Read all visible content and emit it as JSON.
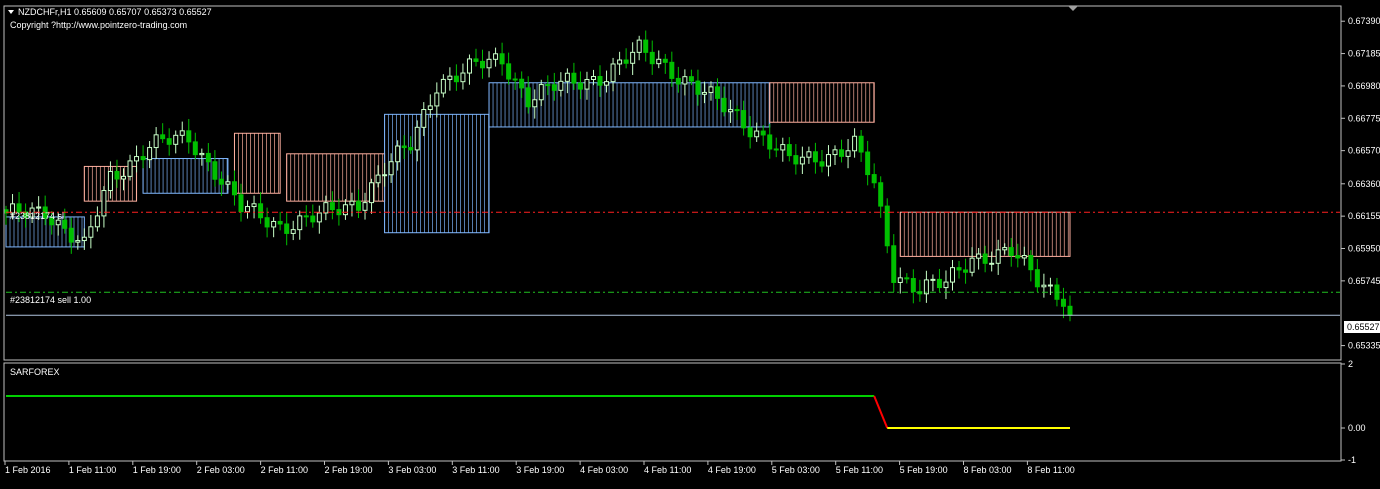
{
  "header": {
    "symbol_line": "NZDCHFr,H1  0.65609 0.65707 0.65373 0.65527",
    "copyright": "Copyright ?http://www.pointzero-trading.com"
  },
  "price_axis": {
    "ticks": [
      "0.67390",
      "0.67185",
      "0.66980",
      "0.66775",
      "0.66570",
      "0.66360",
      "0.66155",
      "0.65950",
      "0.65745",
      "0.65335"
    ],
    "current_price_label": "0.65527"
  },
  "order_lines": {
    "sl_label": "#23812174 sl",
    "sell_label": "#23812174 sell 1.00",
    "sl_price": 0.6618,
    "entry_price": 0.65673,
    "sl_color": "#ff2020",
    "entry_color": "#20c020",
    "bid_color": "#b0c4de"
  },
  "indicator": {
    "name": "SARFOREX",
    "ticks": [
      "2",
      "0.00",
      "-1"
    ],
    "ylim": [
      -1,
      2
    ],
    "segments": [
      {
        "color": "#00d000",
        "from_bar": 0,
        "to_bar": 133,
        "value": 1
      },
      {
        "color": "#ff0000",
        "from_bar": 133,
        "to_bar": 135,
        "value_from": 1,
        "value_to": 0
      },
      {
        "color": "#ffff00",
        "from_bar": 135,
        "to_bar": 163,
        "value": 0
      }
    ]
  },
  "time_axis": {
    "labels": [
      "1 Feb 2016",
      "1 Feb 11:00",
      "1 Feb 19:00",
      "2 Feb 03:00",
      "2 Feb 11:00",
      "2 Feb 19:00",
      "3 Feb 03:00",
      "3 Feb 11:00",
      "3 Feb 19:00",
      "4 Feb 03:00",
      "4 Feb 11:00",
      "4 Feb 19:00",
      "5 Feb 03:00",
      "5 Feb 11:00",
      "5 Feb 19:00",
      "8 Feb 03:00",
      "8 Feb 11:00"
    ]
  },
  "colors": {
    "background": "#000000",
    "frame": "#c0c0c0",
    "bull_candle": "#c8ffc8",
    "bear_candle": "#00c000",
    "band_down": "#ffb0a0",
    "band_up": "#80b8ff"
  },
  "chart_data": {
    "type": "candlestick",
    "symbol": "NZDCHFr",
    "timeframe": "H1",
    "ylim": [
      0.6525,
      0.6748
    ],
    "bar_count": 164,
    "anchors": [
      {
        "bar": 0,
        "price": 0.6615
      },
      {
        "bar": 6,
        "price": 0.662
      },
      {
        "bar": 12,
        "price": 0.6595
      },
      {
        "bar": 16,
        "price": 0.664
      },
      {
        "bar": 22,
        "price": 0.666
      },
      {
        "bar": 28,
        "price": 0.6665
      },
      {
        "bar": 32,
        "price": 0.6645
      },
      {
        "bar": 36,
        "price": 0.662
      },
      {
        "bar": 42,
        "price": 0.661
      },
      {
        "bar": 48,
        "price": 0.6615
      },
      {
        "bar": 54,
        "price": 0.6625
      },
      {
        "bar": 58,
        "price": 0.6645
      },
      {
        "bar": 62,
        "price": 0.666
      },
      {
        "bar": 66,
        "price": 0.67
      },
      {
        "bar": 72,
        "price": 0.671
      },
      {
        "bar": 76,
        "price": 0.6715
      },
      {
        "bar": 80,
        "price": 0.669
      },
      {
        "bar": 86,
        "price": 0.67
      },
      {
        "bar": 92,
        "price": 0.6705
      },
      {
        "bar": 97,
        "price": 0.672
      },
      {
        "bar": 100,
        "price": 0.6715
      },
      {
        "bar": 106,
        "price": 0.6695
      },
      {
        "bar": 112,
        "price": 0.668
      },
      {
        "bar": 116,
        "price": 0.6665
      },
      {
        "bar": 120,
        "price": 0.665
      },
      {
        "bar": 126,
        "price": 0.6655
      },
      {
        "bar": 130,
        "price": 0.666
      },
      {
        "bar": 133,
        "price": 0.6635
      },
      {
        "bar": 136,
        "price": 0.658
      },
      {
        "bar": 140,
        "price": 0.657
      },
      {
        "bar": 144,
        "price": 0.6572
      },
      {
        "bar": 148,
        "price": 0.659
      },
      {
        "bar": 154,
        "price": 0.6592
      },
      {
        "bar": 158,
        "price": 0.6575
      },
      {
        "bar": 162,
        "price": 0.6565
      },
      {
        "bar": 163,
        "price": 0.65527
      }
    ],
    "bands": [
      {
        "from_bar": 0,
        "to_bar": 12,
        "top": 0.6615,
        "bottom": 0.6596,
        "kind": "up"
      },
      {
        "from_bar": 12,
        "to_bar": 20,
        "top": 0.6647,
        "bottom": 0.6625,
        "kind": "down"
      },
      {
        "from_bar": 21,
        "to_bar": 34,
        "top": 0.6652,
        "bottom": 0.663,
        "kind": "up"
      },
      {
        "from_bar": 35,
        "to_bar": 42,
        "top": 0.6668,
        "bottom": 0.663,
        "kind": "down"
      },
      {
        "from_bar": 43,
        "to_bar": 58,
        "top": 0.6655,
        "bottom": 0.6625,
        "kind": "down"
      },
      {
        "from_bar": 58,
        "to_bar": 74,
        "top": 0.668,
        "bottom": 0.6605,
        "kind": "up"
      },
      {
        "from_bar": 74,
        "to_bar": 117,
        "top": 0.67,
        "bottom": 0.6672,
        "kind": "up"
      },
      {
        "from_bar": 117,
        "to_bar": 133,
        "top": 0.67,
        "bottom": 0.6675,
        "kind": "down"
      },
      {
        "from_bar": 137,
        "to_bar": 163,
        "top": 0.6618,
        "bottom": 0.659,
        "kind": "down"
      }
    ]
  }
}
